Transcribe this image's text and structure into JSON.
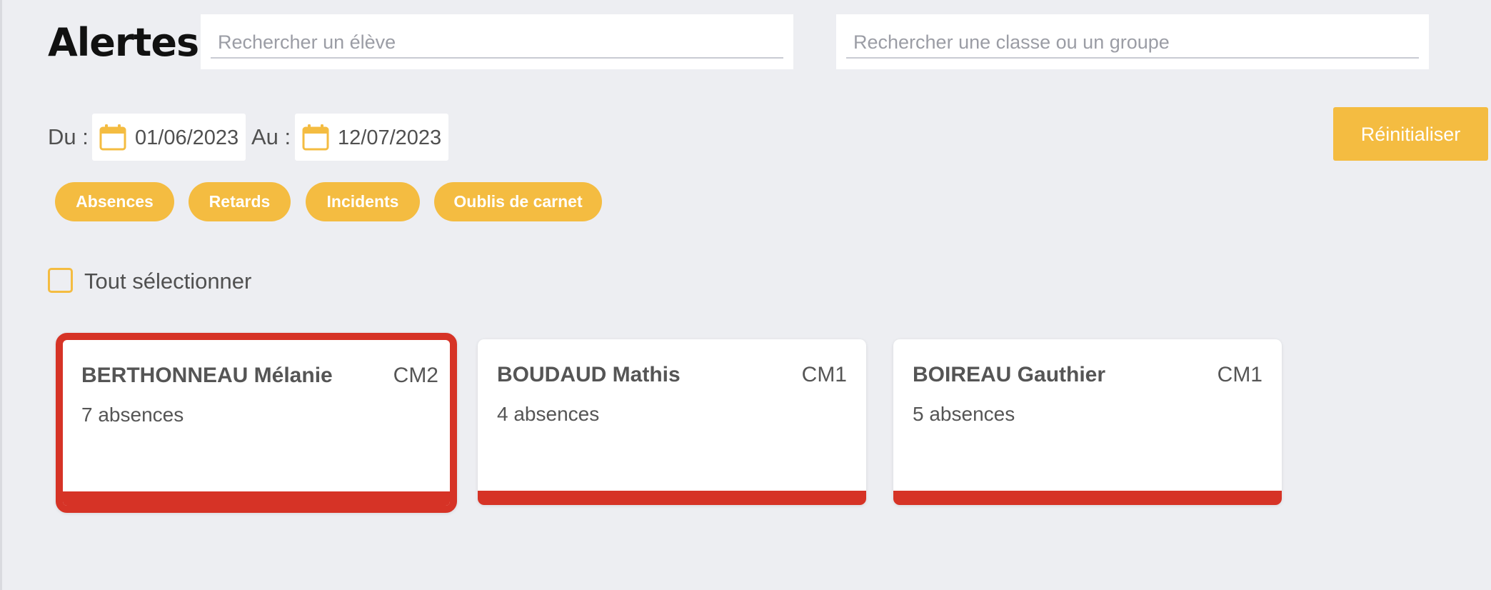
{
  "page": {
    "title": "Alertes"
  },
  "search": {
    "student_placeholder": "Rechercher un élève",
    "student_value": "",
    "class_placeholder": "Rechercher une classe ou un groupe",
    "class_value": ""
  },
  "date_range": {
    "from_label": "Du :",
    "from_value": "01/06/2023",
    "to_label": "Au :",
    "to_value": "12/07/2023",
    "icon": "calendar-icon"
  },
  "reset_label": "Réinitialiser",
  "filters": [
    {
      "label": "Absences"
    },
    {
      "label": "Retards"
    },
    {
      "label": "Incidents"
    },
    {
      "label": "Oublis de carnet"
    }
  ],
  "select_all": {
    "label": "Tout sélectionner",
    "checked": false
  },
  "students": [
    {
      "name": "BERTHONNEAU Mélanie",
      "class": "CM2",
      "count": "7 absences",
      "selected": true
    },
    {
      "name": "BOUDAUD Mathis",
      "class": "CM1",
      "count": "4 absences",
      "selected": false
    },
    {
      "name": "BOIREAU Gauthier",
      "class": "CM1",
      "count": "5 absences",
      "selected": false
    }
  ],
  "colors": {
    "accent": "#f4bc41",
    "alert": "#d63326",
    "background": "#edeef2"
  }
}
